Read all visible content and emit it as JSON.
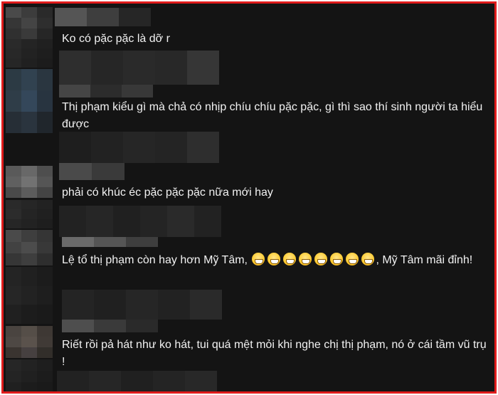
{
  "comments": [
    {
      "text": "Ko có pặc pặc là dỡ r"
    },
    {
      "text": "Thị phạm kiểu gì mà chả có nhịp chíu chíu pặc pặc, gì thì sao thí sinh người ta hiểu được"
    },
    {
      "text": "phải có khúc éc pặc pặc pặc nữa mới hay"
    },
    {
      "text_before": "Lệ tổ thị phạm còn hay hơn Mỹ Tâm,",
      "emoji_count": 8,
      "emoji_name": "grinning-face-icon",
      "text_after": ", Mỹ Tâm mãi đỉnh!"
    },
    {
      "text": "Riết rồi pả hát như ko hát, tui quá mệt mỏi khi nghe chị thị phạm, nó ở cái tầm vũ trụ !"
    }
  ],
  "colors": {
    "border": "#e01c1c",
    "background": "#141414",
    "text": "#f2f2f2"
  }
}
